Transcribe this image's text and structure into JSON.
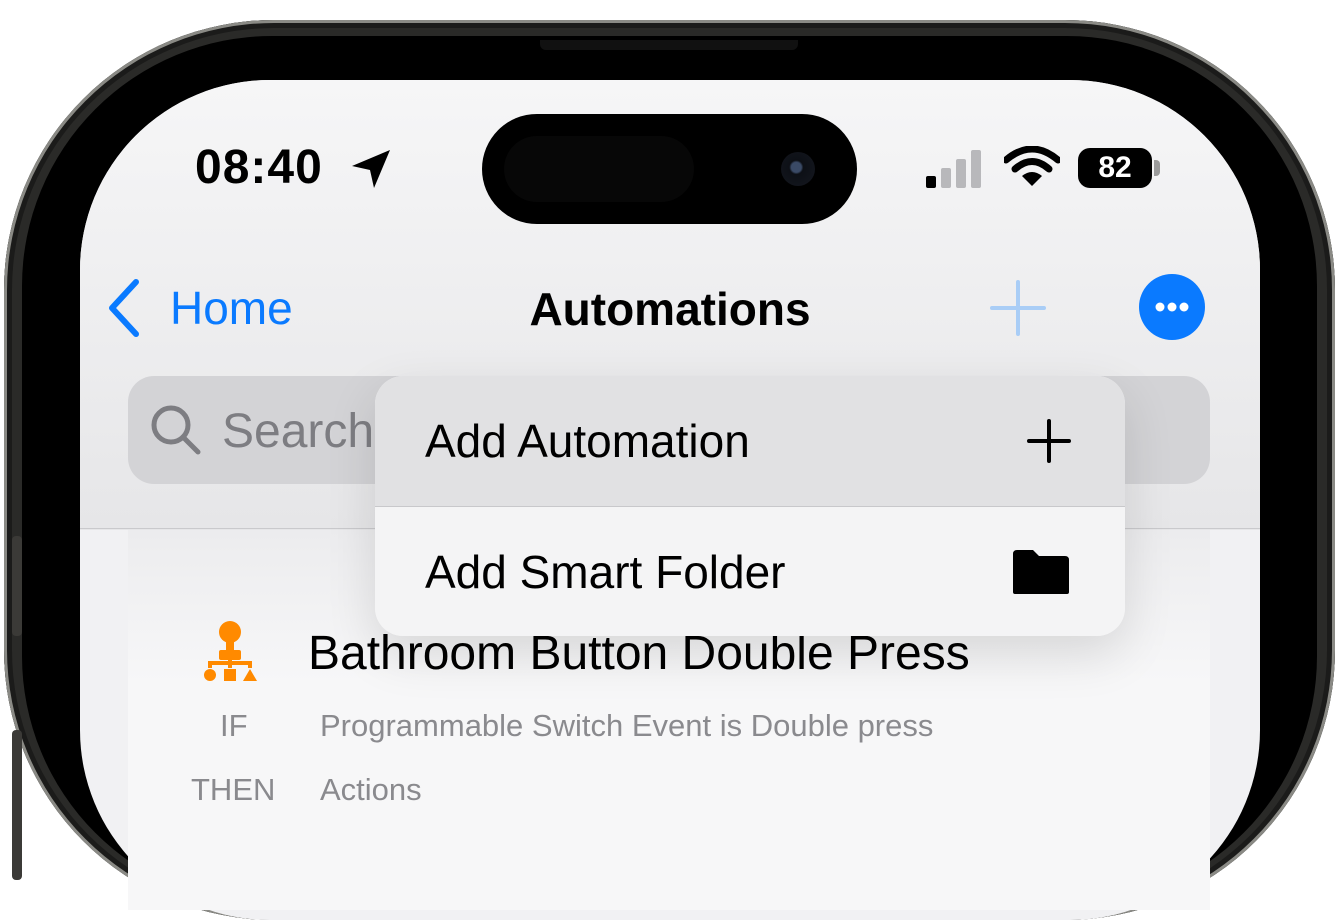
{
  "status_bar": {
    "time": "08:40",
    "battery": "82",
    "icons": [
      "location-arrow-icon",
      "cellular-signal-icon",
      "wifi-icon",
      "battery-icon"
    ]
  },
  "nav": {
    "back_label": "Home",
    "title": "Automations",
    "add_icon": "plus-icon",
    "more_icon": "ellipsis-circle-icon"
  },
  "search": {
    "placeholder": "Search"
  },
  "menu": {
    "items": [
      {
        "label": "Add Automation",
        "icon": "plus-icon"
      },
      {
        "label": "Add Smart Folder",
        "icon": "folder-icon"
      }
    ]
  },
  "automations": [
    {
      "name": "Bathroom Button Double Press",
      "icon": "automation-flowchart-icon",
      "if_label": "IF",
      "if_value": "Programmable Switch Event is Double press",
      "then_label": "THEN",
      "then_value": "Actions"
    }
  ],
  "colors": {
    "accent": "#0a7aff",
    "automation_icon": "#ff8a00",
    "secondary_text": "#8a8a8e"
  }
}
